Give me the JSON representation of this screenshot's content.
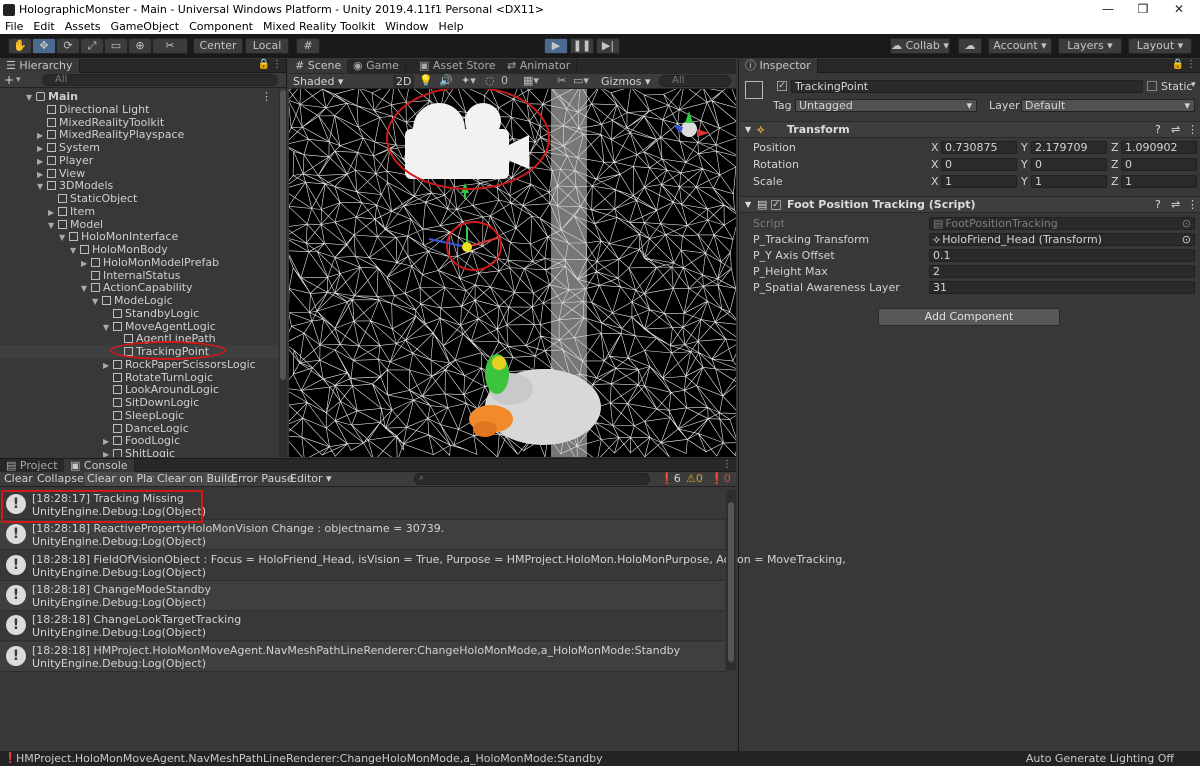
{
  "window": {
    "title": "HolographicMonster - Main - Universal Windows Platform - Unity 2019.4.11f1 Personal <DX11>",
    "controls": [
      "—",
      "❐",
      "✕"
    ]
  },
  "menu": [
    "File",
    "Edit",
    "Assets",
    "GameObject",
    "Component",
    "Mixed Reality Toolkit",
    "Window",
    "Help"
  ],
  "toolbar": {
    "pivot_label": "Center",
    "space_label": "Local",
    "collab_label": "Collab",
    "account_label": "Account",
    "layers_label": "Layers",
    "layout_label": "Layout"
  },
  "hierarchy": {
    "tab": "Hierarchy",
    "search_placeholder": "All",
    "add_label": "+",
    "items": [
      {
        "label": "Main",
        "depth": 0,
        "arrow": "▼",
        "kind": "scene"
      },
      {
        "label": "Directional Light",
        "depth": 1,
        "arrow": ""
      },
      {
        "label": "MixedRealityToolkit",
        "depth": 1,
        "arrow": ""
      },
      {
        "label": "MixedRealityPlayspace",
        "depth": 1,
        "arrow": "▶"
      },
      {
        "label": "System",
        "depth": 1,
        "arrow": "▶"
      },
      {
        "label": "Player",
        "depth": 1,
        "arrow": "▶"
      },
      {
        "label": "View",
        "depth": 1,
        "arrow": "▶"
      },
      {
        "label": "3DModels",
        "depth": 1,
        "arrow": "▼"
      },
      {
        "label": "StaticObject",
        "depth": 2,
        "arrow": ""
      },
      {
        "label": "Item",
        "depth": 2,
        "arrow": "▶"
      },
      {
        "label": "Model",
        "depth": 2,
        "arrow": "▼"
      },
      {
        "label": "HoloMonInterface",
        "depth": 3,
        "arrow": "▼"
      },
      {
        "label": "HoloMonBody",
        "depth": 4,
        "arrow": "▼"
      },
      {
        "label": "HoloMonModelPrefab",
        "depth": 5,
        "arrow": "▶"
      },
      {
        "label": "InternalStatus",
        "depth": 5,
        "arrow": ""
      },
      {
        "label": "ActionCapability",
        "depth": 5,
        "arrow": "▼"
      },
      {
        "label": "ModeLogic",
        "depth": 6,
        "arrow": "▼"
      },
      {
        "label": "StandbyLogic",
        "depth": 7,
        "arrow": ""
      },
      {
        "label": "MoveAgentLogic",
        "depth": 7,
        "arrow": "▼"
      },
      {
        "label": "AgentLinePath",
        "depth": 8,
        "arrow": ""
      },
      {
        "label": "TrackingPoint",
        "depth": 8,
        "arrow": "",
        "selected": true
      },
      {
        "label": "RockPaperScissorsLogic",
        "depth": 7,
        "arrow": "▶"
      },
      {
        "label": "RotateTurnLogic",
        "depth": 7,
        "arrow": ""
      },
      {
        "label": "LookAroundLogic",
        "depth": 7,
        "arrow": ""
      },
      {
        "label": "SitDownLogic",
        "depth": 7,
        "arrow": ""
      },
      {
        "label": "SleepLogic",
        "depth": 7,
        "arrow": ""
      },
      {
        "label": "DanceLogic",
        "depth": 7,
        "arrow": ""
      },
      {
        "label": "FoodLogic",
        "depth": 7,
        "arrow": "▶"
      },
      {
        "label": "ShitLogic",
        "depth": 7,
        "arrow": "▶"
      }
    ]
  },
  "scene": {
    "tabs": [
      "Scene",
      "Game",
      "Asset Store",
      "Animator"
    ],
    "shading": "Shaded",
    "mode_2d": "2D",
    "gizmos": "Gizmos",
    "search_placeholder": "All",
    "gizmo_count": "0"
  },
  "inspector": {
    "tab": "Inspector",
    "object_name": "TrackingPoint",
    "static_label": "Static",
    "tag_label": "Tag",
    "tag_value": "Untagged",
    "layer_label": "Layer",
    "layer_value": "Default",
    "transform": {
      "title": "Transform",
      "rows": [
        {
          "label": "Position",
          "x": "0.730875",
          "y": "2.179709",
          "z": "1.090902"
        },
        {
          "label": "Rotation",
          "x": "0",
          "y": "0",
          "z": "0"
        },
        {
          "label": "Scale",
          "x": "1",
          "y": "1",
          "z": "1"
        }
      ],
      "axis_x": "X",
      "axis_y": "Y",
      "axis_z": "Z"
    },
    "script_component": {
      "title": "Foot Position Tracking (Script)",
      "rows": [
        {
          "label": "Script",
          "value": "FootPositionTracking"
        },
        {
          "label": "P_Tracking Transform",
          "value": "HoloFriend_Head (Transform)"
        },
        {
          "label": "P_Y Axis Offset",
          "value": "0.1"
        },
        {
          "label": "P_Height Max",
          "value": "2"
        },
        {
          "label": "P_Spatial Awareness Layer",
          "value": "31"
        }
      ]
    },
    "add_component": "Add Component"
  },
  "console": {
    "tabs": [
      "Project",
      "Console"
    ],
    "buttons": [
      "Clear",
      "Collapse",
      "Clear on Play",
      "Clear on Build",
      "Error Pause",
      "Editor"
    ],
    "counts": {
      "info": "6",
      "warn": "0",
      "error": "0"
    },
    "entries": [
      {
        "line1": "[18:28:17] Tracking Missing",
        "line2": "UnityEngine.Debug:Log(Object)"
      },
      {
        "line1": "[18:28:18] ReactivePropertyHoloMonVision Change : objectname = 30739.",
        "line2": "UnityEngine.Debug:Log(Object)"
      },
      {
        "line1": "[18:28:18] FieldOfVisionObject : Focus = HoloFriend_Head, isVision = True, Purpose = HMProject.HoloMon.HoloMonPurpose, Action = MoveTracking,",
        "line2": "UnityEngine.Debug:Log(Object)"
      },
      {
        "line1": "[18:28:18] ChangeModeStandby",
        "line2": "UnityEngine.Debug:Log(Object)"
      },
      {
        "line1": "[18:28:18] ChangeLookTargetTracking",
        "line2": "UnityEngine.Debug:Log(Object)"
      },
      {
        "line1": "[18:28:18] HMProject.HoloMonMoveAgent.NavMeshPathLineRenderer:ChangeHoloMonMode,a_HoloMonMode:Standby",
        "line2": "UnityEngine.Debug:Log(Object)"
      }
    ]
  },
  "status": {
    "message": "HMProject.HoloMonMoveAgent.NavMeshPathLineRenderer:ChangeHoloMonMode,a_HoloMonMode:Standby",
    "right": "Auto Generate Lighting Off"
  }
}
